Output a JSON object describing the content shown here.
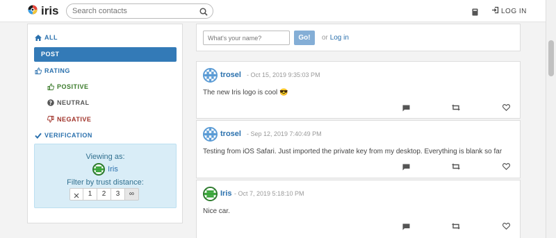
{
  "app": {
    "name": "iris"
  },
  "search": {
    "placeholder": "Search contacts"
  },
  "nav": {
    "login_label": "LOG IN"
  },
  "sidebar": {
    "all_label": "ALL",
    "post_label": "POST",
    "rating_label": "RATING",
    "positive_label": "POSITIVE",
    "neutral_label": "NEUTRAL",
    "negative_label": "NEGATIVE",
    "verification_label": "VERIFICATION"
  },
  "viewing": {
    "label": "Viewing as:",
    "user": "Iris",
    "filter_label": "Filter by trust distance:",
    "options": [
      "1",
      "2",
      "3",
      "∞"
    ],
    "active_option": "∞"
  },
  "login_form": {
    "name_placeholder": "What's your name?",
    "go_label": "Go!",
    "or_text": "or",
    "login_link": "Log in"
  },
  "posts": [
    {
      "author": "trosel",
      "date": "- Oct 15, 2019 9:35:03 PM",
      "text": "The new Iris logo is cool 😎"
    },
    {
      "author": "trosel",
      "date": "- Sep 12, 2019 7:40:49 PM",
      "text": "Testing from iOS Safari. Just imported the private key from my desktop. Everything is blank so far"
    },
    {
      "author": "Iris",
      "date": "- Oct 7, 2019 5:18:10 PM",
      "text": "Nice car."
    }
  ],
  "colors": {
    "accent": "#337ab7",
    "info_bg": "#d9edf7",
    "go_button": "#84aed6",
    "positive": "#3a7a2a",
    "negative": "#a0332a"
  }
}
